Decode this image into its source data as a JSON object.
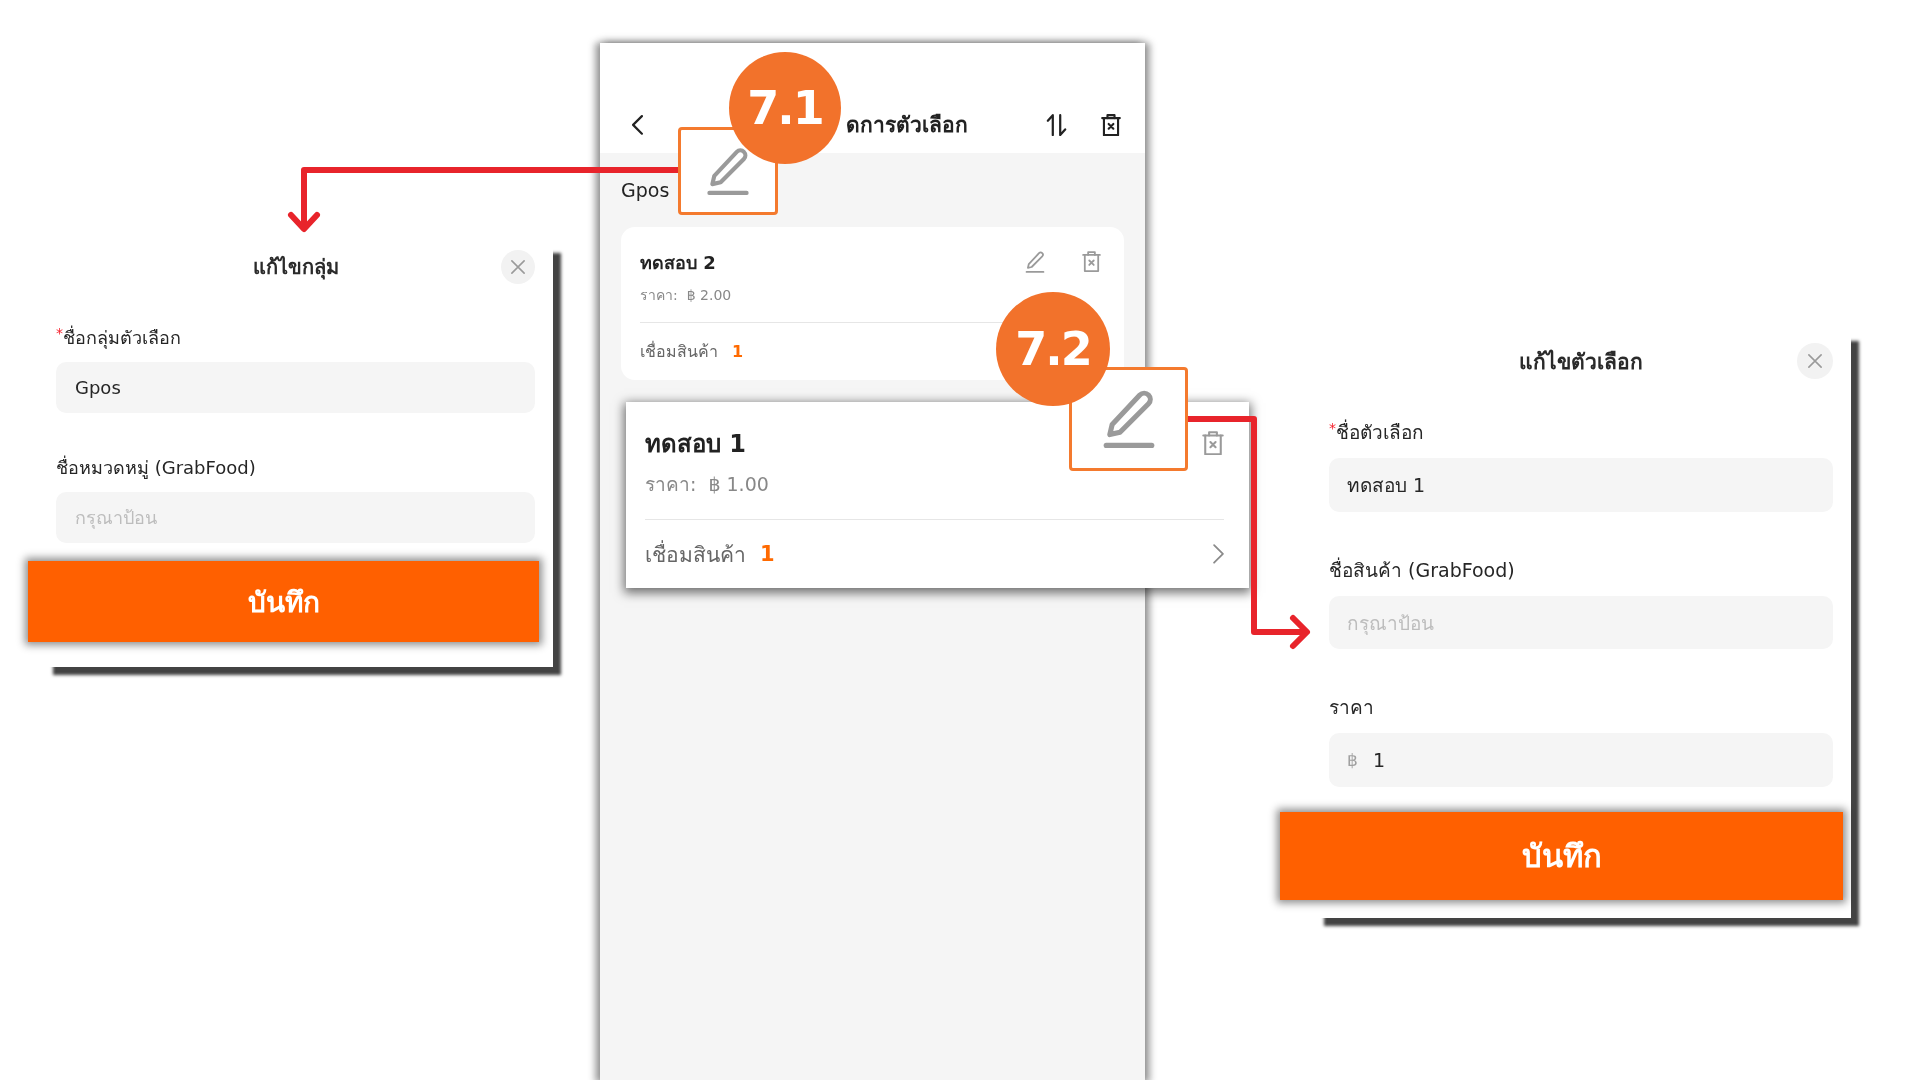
{
  "edit_group_dialog": {
    "title": "แก้ไขกลุ่ม",
    "fields": [
      {
        "required_mark": "*",
        "label": "ชื่อกลุ่มตัวเลือก",
        "value": "Gpos"
      },
      {
        "label": "ชื่อหมวดหมู่ (GrabFood)",
        "placeholder": "กรุณาป้อน"
      }
    ],
    "save_button": "บันทึก"
  },
  "option_manager": {
    "header": {
      "title": "ดการตัวเลือก"
    },
    "group": {
      "name": "Gpos",
      "step": "7.1"
    },
    "options": [
      {
        "name": "ทดสอบ 2",
        "price_label": "ราคา:",
        "price": "฿ 2.00",
        "link_label": "เชื่อมสินค้า",
        "link_count": "1",
        "magnified": false
      },
      {
        "name": "ทดสอบ 1",
        "price_label": "ราคา:",
        "price": "฿ 1.00",
        "link_label": "เชื่อมสินค้า",
        "link_count": "1",
        "magnified": true,
        "step": "7.2"
      }
    ]
  },
  "edit_option_dialog": {
    "title": "แก้ไขตัวเลือก",
    "fields": [
      {
        "required_mark": "*",
        "label": "ชื่อตัวเลือก",
        "value": "ทดสอบ 1"
      },
      {
        "label": "ชื่อสินค้า (GrabFood)",
        "placeholder": "กรุณาป้อน"
      },
      {
        "label": "ราคา",
        "prefix": "฿",
        "value": "1"
      }
    ],
    "save_button": "บันทึก"
  }
}
